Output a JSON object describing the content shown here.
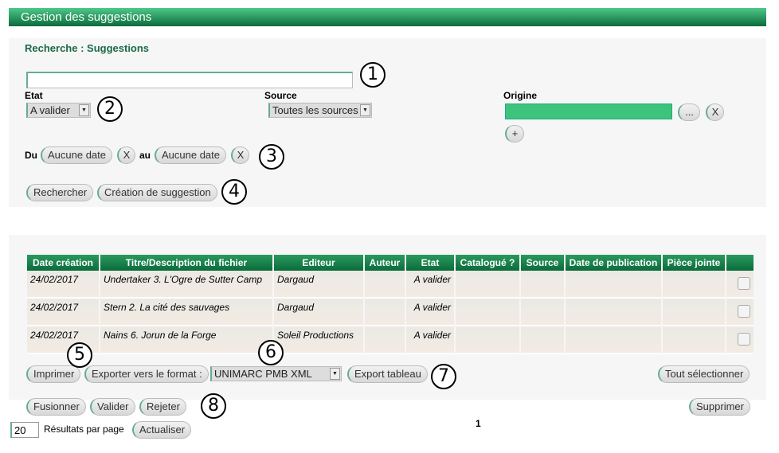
{
  "header": {
    "title": "Gestion des suggestions"
  },
  "search": {
    "title": "Recherche : Suggestions",
    "query_value": "",
    "etat_label": "Etat",
    "etat_value": "A valider",
    "source_label": "Source",
    "source_value": "Toutes les sources",
    "origine_label": "Origine",
    "origine_browse": "...",
    "origine_clear": "X",
    "origine_add": "+",
    "du_label": "Du",
    "date_from": "Aucune date",
    "clear": "X",
    "au_label": "au",
    "date_to": "Aucune date",
    "search_button": "Rechercher",
    "create_button": "Création de suggestion"
  },
  "table": {
    "columns": [
      "Date création",
      "Titre/Description du fichier",
      "Editeur",
      "Auteur",
      "Etat",
      "Catalogué ?",
      "Source",
      "Date de publication",
      "Pièce jointe",
      ""
    ],
    "rows": [
      [
        "24/02/2017",
        "Undertaker 3. L'Ogre de Sutter Camp",
        "Dargaud",
        "",
        "A valider",
        "",
        "",
        "",
        ""
      ],
      [
        "24/02/2017",
        "Stern 2. La cité des sauvages",
        "Dargaud",
        "",
        "A valider",
        "",
        "",
        "",
        ""
      ],
      [
        "24/02/2017",
        "Nains 6. Jorun de la Forge",
        "Soleil Productions",
        "",
        "A valider",
        "",
        "",
        "",
        ""
      ]
    ]
  },
  "actions": {
    "print": "Imprimer",
    "export_to": "Exporter vers le format :",
    "export_format": "UNIMARC PMB XML",
    "export_table": "Export tableau",
    "select_all": "Tout sélectionner",
    "merge": "Fusionner",
    "validate": "Valider",
    "reject": "Rejeter",
    "delete": "Supprimer"
  },
  "pagination": {
    "per_page_value": "20",
    "per_page_label": "Résultats par page",
    "refresh": "Actualiser",
    "page": "1"
  },
  "markers": [
    "1",
    "2",
    "3",
    "4",
    "5",
    "6",
    "7",
    "8"
  ]
}
